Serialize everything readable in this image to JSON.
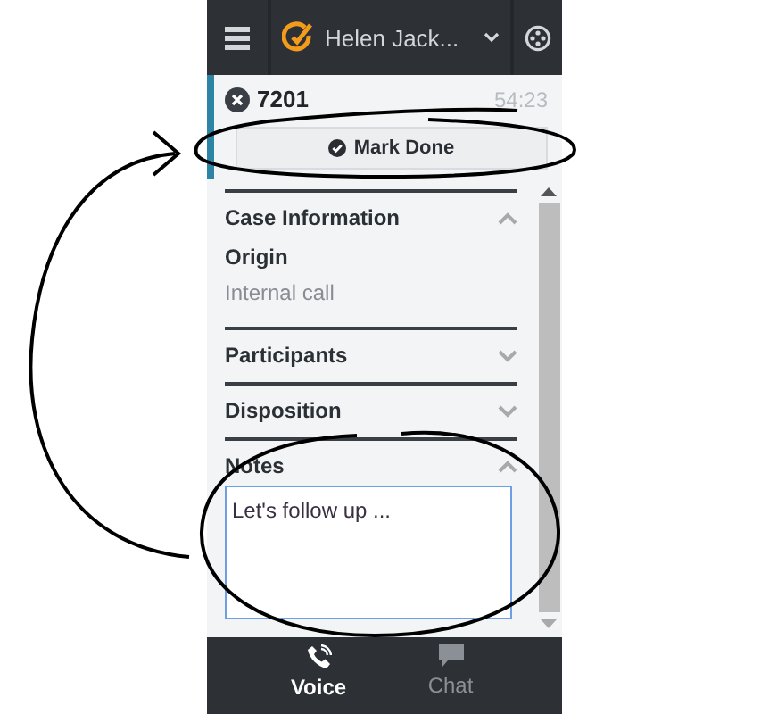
{
  "top_bar": {
    "user_name": "Helen Jack..."
  },
  "call": {
    "number": "7201",
    "time": "54:23",
    "action": "Mark Done"
  },
  "sections": [
    {
      "title": "Case Information",
      "expanded": true,
      "kind": "fields",
      "fields": [
        {
          "label": "Origin",
          "value": "Internal call"
        }
      ]
    },
    {
      "title": "Participants",
      "expanded": false
    },
    {
      "title": "Disposition",
      "expanded": false
    },
    {
      "title": "Notes",
      "expanded": true,
      "kind": "notes",
      "value": "Let's follow up ..."
    }
  ],
  "tabs": [
    {
      "label": "Voice",
      "selected": true,
      "kind": "voice"
    },
    {
      "label": "Chat",
      "selected": false,
      "kind": "chat"
    }
  ]
}
